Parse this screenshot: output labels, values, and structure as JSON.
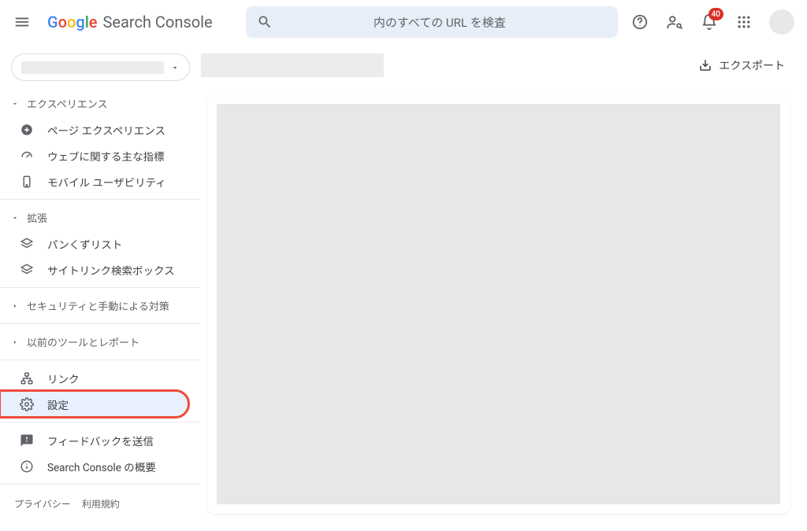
{
  "header": {
    "product_name": "Search Console",
    "search_placeholder": "内のすべての URL を検査",
    "notification_count": "40"
  },
  "sidebar": {
    "sections": {
      "experience": {
        "label": "エクスペリエンス",
        "items": [
          {
            "label": "ページ エクスペリエンス"
          },
          {
            "label": "ウェブに関する主な指標"
          },
          {
            "label": "モバイル ユーザビリティ"
          }
        ]
      },
      "enhancements": {
        "label": "拡張",
        "items": [
          {
            "label": "パンくずリスト"
          },
          {
            "label": "サイトリンク検索ボックス"
          }
        ]
      },
      "security": {
        "label": "セキュリティと手動による対策"
      },
      "legacy": {
        "label": "以前のツールとレポート"
      }
    },
    "bottom": {
      "links_label": "リンク",
      "settings_label": "設定",
      "feedback_label": "フィードバックを送信",
      "about_label": "Search Console の概要"
    },
    "footer": {
      "privacy": "プライバシー",
      "terms": "利用規約"
    }
  },
  "main": {
    "export_label": "エクスポート"
  }
}
